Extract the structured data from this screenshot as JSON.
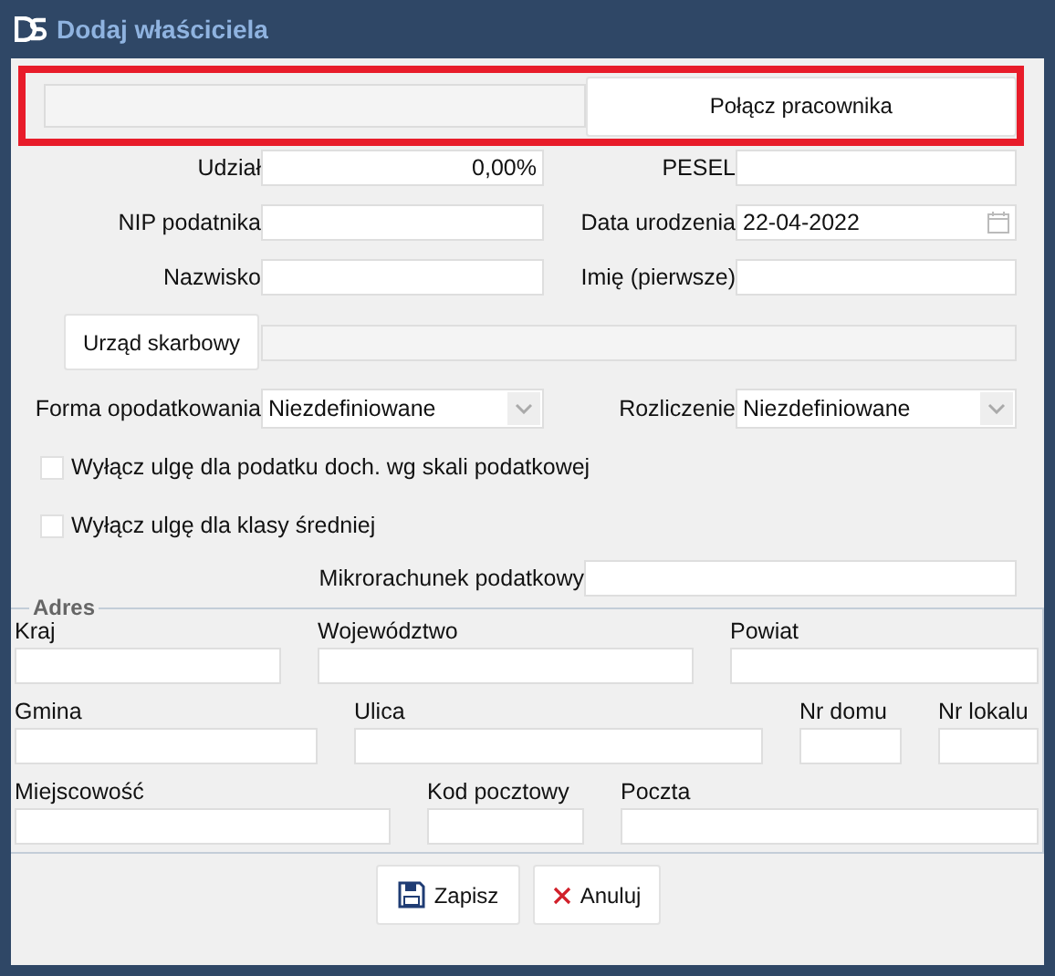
{
  "window": {
    "title": "Dodaj właściciela"
  },
  "link_bar": {
    "button": "Połącz pracownika",
    "highlighted": true
  },
  "fields": [
    {
      "label": "Udział",
      "value": "0,00%",
      "kind": "number"
    },
    {
      "label": "PESEL",
      "kind": "text"
    },
    {
      "label": "NIP podatnika",
      "kind": "text"
    },
    {
      "label": "Data urodzenia",
      "value": "22-04-2022",
      "kind": "date"
    },
    {
      "label": "Nazwisko",
      "kind": "text"
    },
    {
      "label": "Imię (pierwsze)",
      "kind": "text"
    }
  ],
  "tax_office": {
    "button": "Urząd skarbowy"
  },
  "selects": [
    {
      "label": "Forma opodatkowania",
      "value": "Niezdefiniowane"
    },
    {
      "label": "Rozliczenie",
      "value": "Niezdefiniowane"
    }
  ],
  "checkboxes": [
    {
      "label": "Wyłącz ulgę dla podatku doch. wg skali podatkowej",
      "checked": false
    },
    {
      "label": "Wyłącz ulgę dla klasy średniej",
      "checked": false
    }
  ],
  "micro_account": {
    "label": "Mikrorachunek podatkowy"
  },
  "address": {
    "title": "Adres",
    "rows": [
      [
        {
          "label": "Kraj"
        },
        {
          "label": "Województwo"
        },
        {
          "label": "Powiat"
        }
      ],
      [
        {
          "label": "Gmina"
        },
        {
          "label": "Ulica"
        },
        {
          "label": "Nr domu"
        },
        {
          "label": "Nr lokalu"
        }
      ],
      [
        {
          "label": "Miejscowość"
        },
        {
          "label": "Kod pocztowy"
        },
        {
          "label": "Poczta"
        }
      ]
    ]
  },
  "buttons": [
    {
      "label": "Zapisz",
      "kind": "save"
    },
    {
      "label": "Anuluj",
      "kind": "cancel"
    }
  ]
}
